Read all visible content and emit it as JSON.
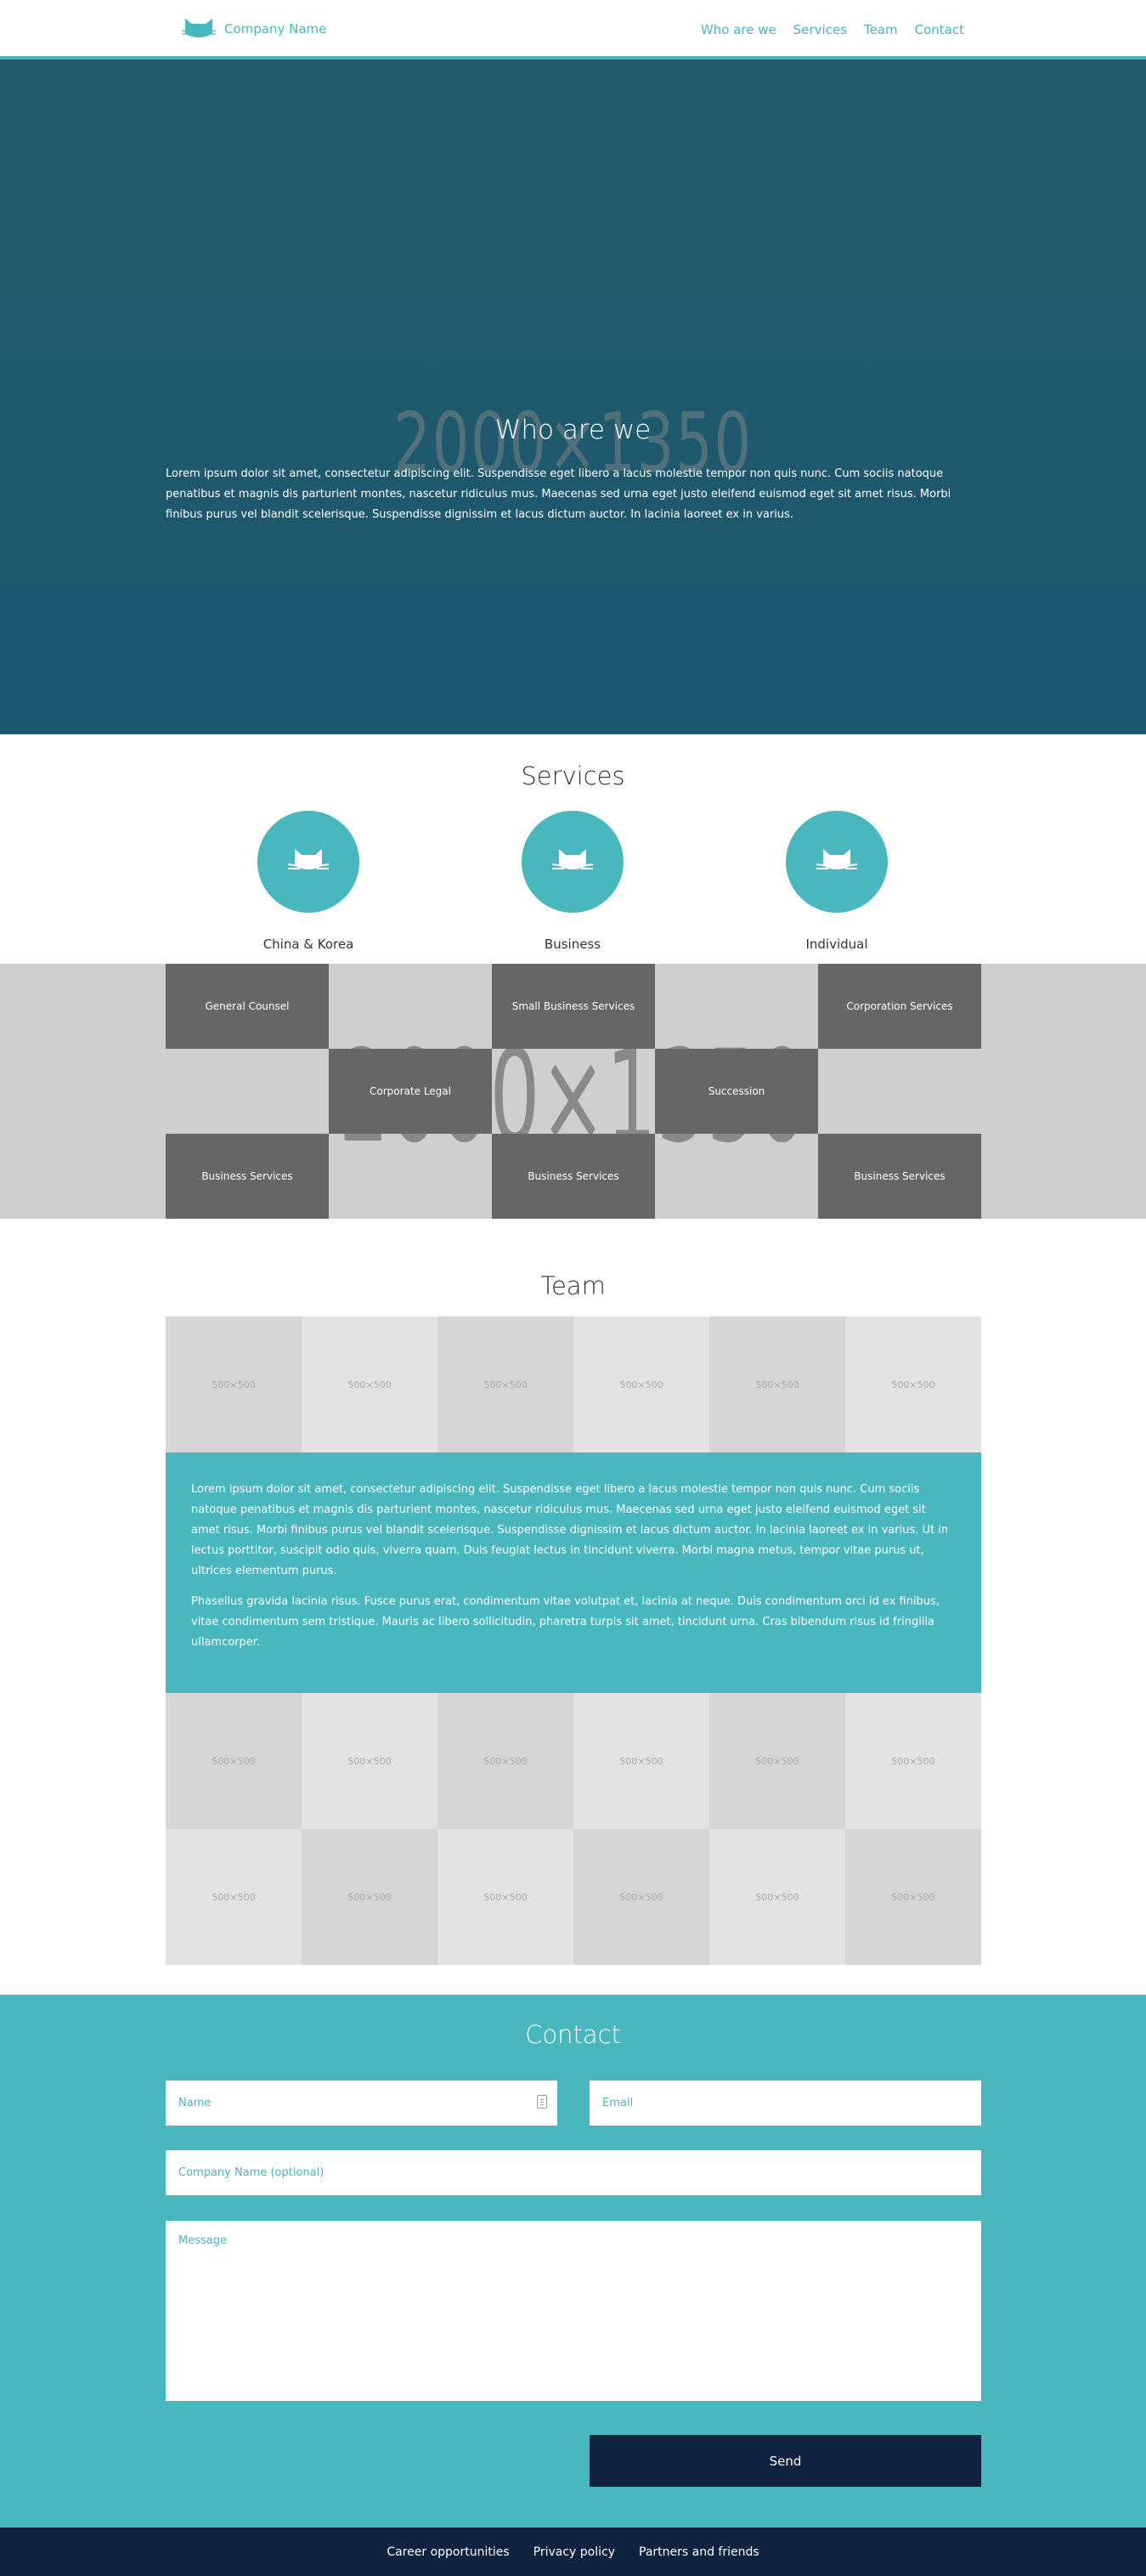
{
  "header": {
    "company_name": "Company Name",
    "nav": [
      "Who are we",
      "Services",
      "Team",
      "Contact"
    ]
  },
  "hero": {
    "placeholder": "2000×1350",
    "title": "Who are we",
    "text": "Lorem ipsum dolor sit amet, consectetur adipiscing elit. Suspendisse eget libero a lacus molestie tempor non quis nunc. Cum sociis natoque penatibus et magnis dis parturient montes, nascetur ridiculus mus. Maecenas sed urna eget justo eleifend euismod eget sit amet risus. Morbi finibus purus vel blandit scelerisque. Suspendisse dignissim et lacus dictum auctor. In lacinia laoreet ex in varius."
  },
  "services": {
    "title": "Services",
    "items": [
      "China & Korea",
      "Business",
      "Individual"
    ],
    "grid_placeholder": "2000×1350",
    "tiles": [
      "General Counsel",
      "Small Business Services",
      "Corporation Services",
      "Corporate Legal",
      "Succession",
      "Business Services",
      "Business Services",
      "Business Services"
    ]
  },
  "team": {
    "title": "Team",
    "placeholder": "500×500",
    "paragraphs": [
      "Lorem ipsum dolor sit amet, consectetur adipiscing elit. Suspendisse eget libero a lacus molestie tempor non quis nunc. Cum sociis natoque penatibus et magnis dis parturient montes, nascetur ridiculus mus. Maecenas sed urna eget justo eleifend euismod eget sit amet risus. Morbi finibus purus vel blandit scelerisque. Suspendisse dignissim et lacus dictum auctor. In lacinia laoreet ex in varius. Ut in lectus porttitor, suscipit odio quis, viverra quam. Duis feugiat lectus in tincidunt viverra. Morbi magna metus, tempor vitae purus ut, ultrices elementum purus.",
      "Phasellus gravida lacinia risus. Fusce purus erat, condimentum vitae volutpat et, lacinia at neque. Duis condimentum orci id ex finibus, vitae condimentum sem tristique. Mauris ac libero sollicitudin, pharetra turpis sit amet, tincidunt urna. Cras bibendum risus id fringilla ullamcorper."
    ]
  },
  "contact": {
    "title": "Contact",
    "name_placeholder": "Name",
    "email_placeholder": "Email",
    "company_placeholder": "Company Name (optional)",
    "message_placeholder": "Message",
    "send_label": "Send"
  },
  "footer": {
    "links": [
      "Career opportunities",
      "Privacy policy",
      "Partners and friends"
    ]
  },
  "colors": {
    "accent": "#48b7be",
    "hero_bg": "#225c6a",
    "dark_navy": "#0f2340",
    "tile": "#666666"
  }
}
